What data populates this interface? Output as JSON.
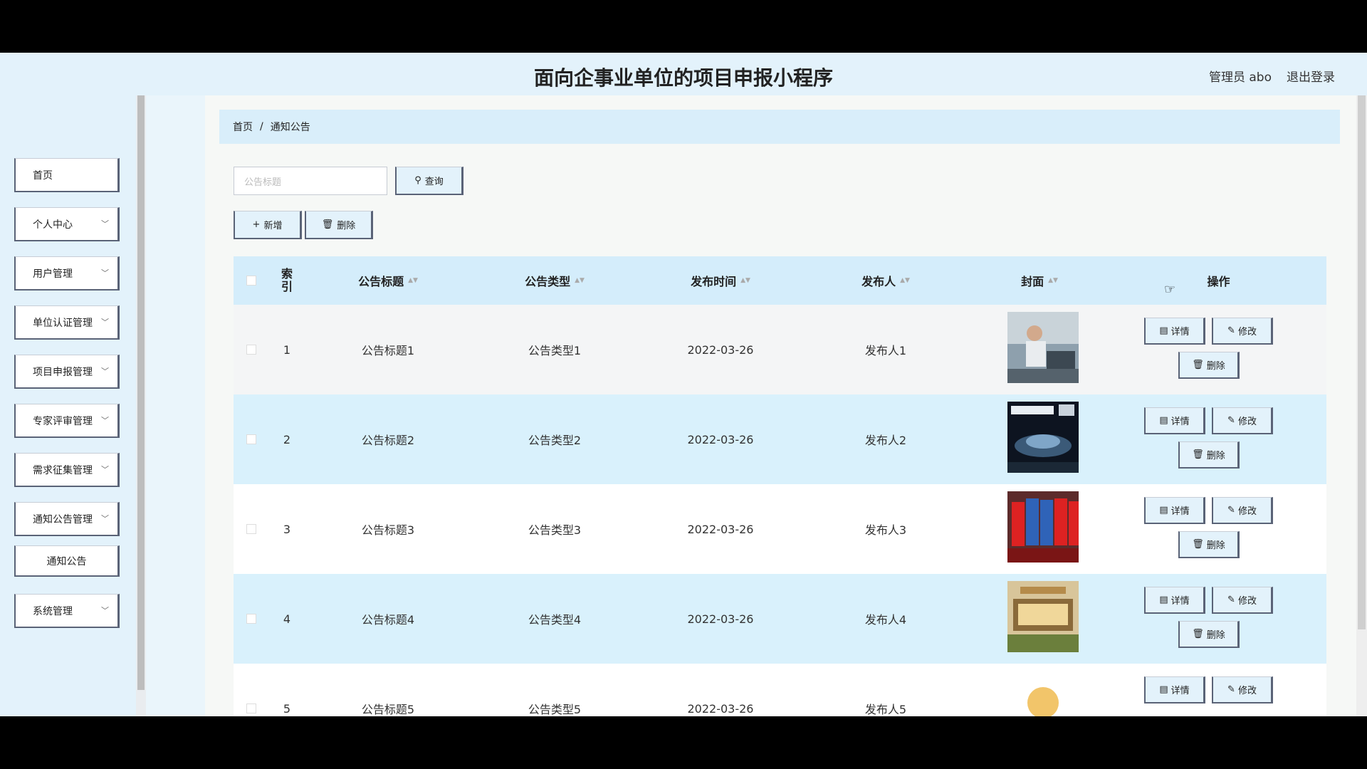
{
  "app": {
    "title": "面向企事业单位的项目申报小程序",
    "admin": "管理员 abo",
    "logout": "退出登录"
  },
  "sidebar": {
    "items": [
      {
        "label": "首页"
      },
      {
        "label": "个人中心"
      },
      {
        "label": "用户管理"
      },
      {
        "label": "单位认证管理"
      },
      {
        "label": "项目申报管理"
      },
      {
        "label": "专家评审管理"
      },
      {
        "label": "需求征集管理"
      },
      {
        "label": "通知公告管理"
      },
      {
        "label": "通知公告"
      },
      {
        "label": "系统管理"
      }
    ]
  },
  "breadcrumb": {
    "home": "首页",
    "sep": "/",
    "current": "通知公告"
  },
  "search": {
    "placeholder": "公告标题",
    "button": "查询"
  },
  "toolbar": {
    "add": "新增",
    "delete": "删除"
  },
  "table": {
    "headers": [
      "索引",
      "公告标题",
      "公告类型",
      "发布时间",
      "发布人",
      "封面",
      "操作"
    ],
    "rows": [
      {
        "index": "1",
        "title": "公告标题1",
        "type": "公告类型1",
        "time": "2022-03-26",
        "author": "发布人1",
        "cover_icon": "gym-photo"
      },
      {
        "index": "2",
        "title": "公告标题2",
        "type": "公告类型2",
        "time": "2022-03-26",
        "author": "发布人2",
        "cover_icon": "car-poster"
      },
      {
        "index": "3",
        "title": "公告标题3",
        "type": "公告类型3",
        "time": "2022-03-26",
        "author": "发布人3",
        "cover_icon": "flags-photo"
      },
      {
        "index": "4",
        "title": "公告标题4",
        "type": "公告类型4",
        "time": "2022-03-26",
        "author": "发布人4",
        "cover_icon": "store-photo"
      },
      {
        "index": "5",
        "title": "公告标题5",
        "type": "公告类型5",
        "time": "2022-03-26",
        "author": "发布人5",
        "cover_icon": "logo"
      }
    ],
    "ops": {
      "detail": "详情",
      "edit": "修改",
      "delete": "删除"
    }
  },
  "colors": {
    "accent": "#5a6377",
    "header_bg": "#d4edfb",
    "row_alt": "#d9f1fc"
  }
}
